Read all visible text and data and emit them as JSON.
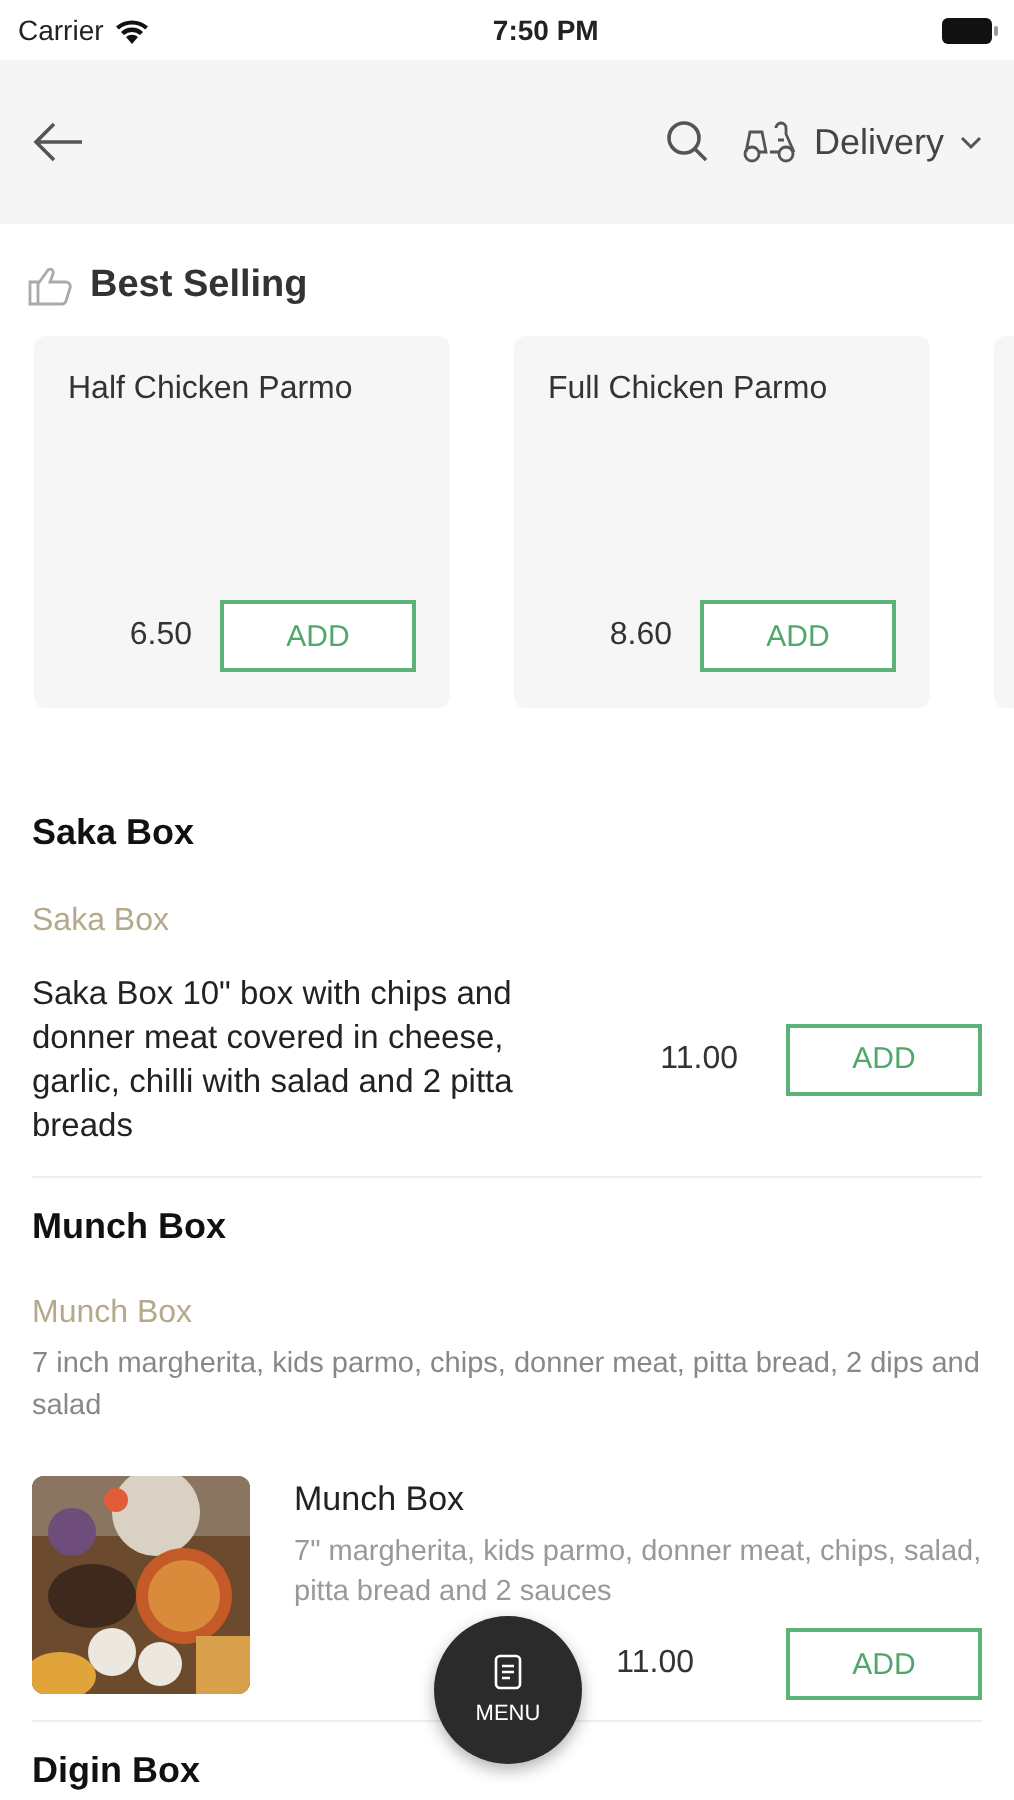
{
  "status_bar": {
    "carrier": "Carrier",
    "time": "7:50 PM"
  },
  "header": {
    "order_mode": "Delivery"
  },
  "best_selling": {
    "title": "Best Selling",
    "items": [
      {
        "name": "Half Chicken Parmo",
        "price": "6.50",
        "button": "ADD"
      },
      {
        "name": "Full Chicken Parmo",
        "price": "8.60",
        "button": "ADD"
      }
    ]
  },
  "sections": [
    {
      "title": "Saka Box",
      "subtitle": "Saka Box",
      "items": [
        {
          "kind": "text",
          "name": "Saka Box 10\" box with chips and donner meat covered in cheese, garlic, chilli with salad and 2 pitta breads",
          "price": "11.00",
          "button": "ADD"
        }
      ]
    },
    {
      "title": "Munch Box",
      "subtitle": "Munch Box",
      "description": "7 inch margherita, kids parmo, chips, donner meat, pitta bread, 2 dips and salad",
      "items": [
        {
          "kind": "picture",
          "name": "Munch Box",
          "description": "7\" margherita, kids parmo, donner meat, chips, salad, pitta bread and 2 sauces",
          "price": "11.00",
          "button": "ADD"
        }
      ]
    },
    {
      "title": "Digin Box"
    }
  ],
  "menu_button": {
    "label": "MENU"
  }
}
